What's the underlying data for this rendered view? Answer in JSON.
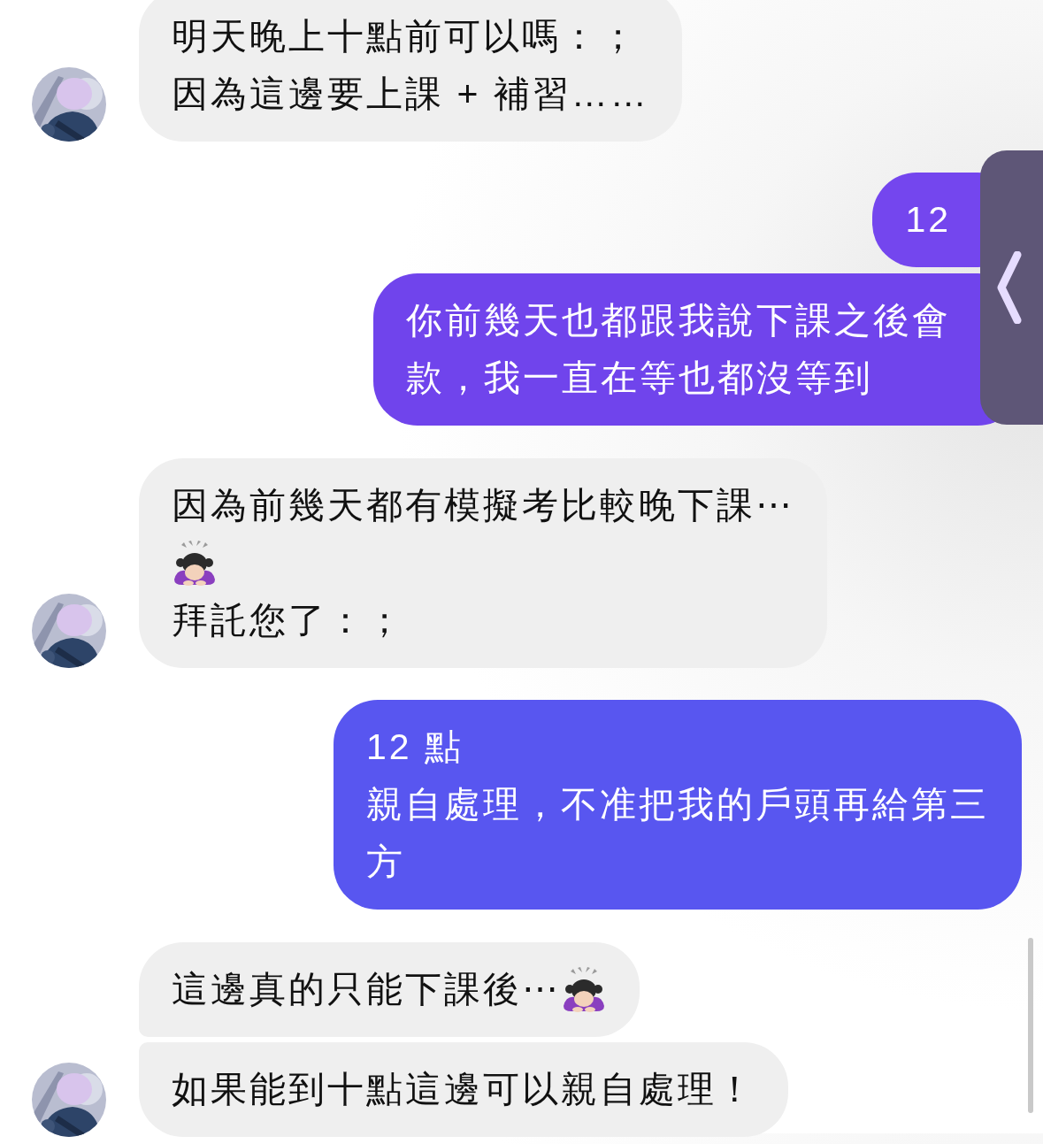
{
  "messages": [
    {
      "kind": "incoming",
      "avatar": true,
      "joined_below": false,
      "joined_above": false,
      "lines": [
        [
          {
            "kind": "text",
            "text": "明天晚上十點前可以嗎：；"
          }
        ],
        [
          {
            "kind": "text",
            "text": "因為這邊要上課 + 補習……"
          }
        ]
      ]
    },
    {
      "kind": "outgoing",
      "color": "#7446ee",
      "covered": true,
      "lines": [
        [
          {
            "kind": "text",
            "text": "12"
          }
        ]
      ]
    },
    {
      "kind": "outgoing",
      "color": "#7044ec",
      "covered": true,
      "lines": [
        [
          {
            "kind": "text",
            "text": "你前幾天也都跟我說下課之後會"
          }
        ],
        [
          {
            "kind": "text",
            "text": "款，我一直在等也都沒等到"
          }
        ]
      ]
    },
    {
      "kind": "incoming",
      "avatar": true,
      "joined_below": false,
      "joined_above": false,
      "lines": [
        [
          {
            "kind": "text",
            "text": "因為前幾天都有模擬考比較晚下課⋯"
          }
        ],
        [
          {
            "kind": "emoji"
          }
        ],
        [
          {
            "kind": "text",
            "text": "拜託您了：；"
          }
        ]
      ]
    },
    {
      "kind": "outgoing",
      "color": "#5856f0",
      "covered": false,
      "lines": [
        [
          {
            "kind": "text",
            "text": "12 點"
          }
        ],
        [
          {
            "kind": "text",
            "text": "親自處理，不准把我的戶頭再給第三"
          }
        ],
        [
          {
            "kind": "text",
            "text": "方"
          }
        ]
      ]
    },
    {
      "kind": "incoming",
      "avatar": false,
      "joined_below": true,
      "joined_above": false,
      "lines": [
        [
          {
            "kind": "text",
            "text": "這邊真的只能下課後⋯"
          },
          {
            "kind": "emoji"
          }
        ]
      ]
    },
    {
      "kind": "incoming",
      "avatar": true,
      "joined_below": false,
      "joined_above": true,
      "lines": [
        [
          {
            "kind": "text",
            "text": "如果能到十點這邊可以親自處理！"
          }
        ]
      ]
    }
  ]
}
